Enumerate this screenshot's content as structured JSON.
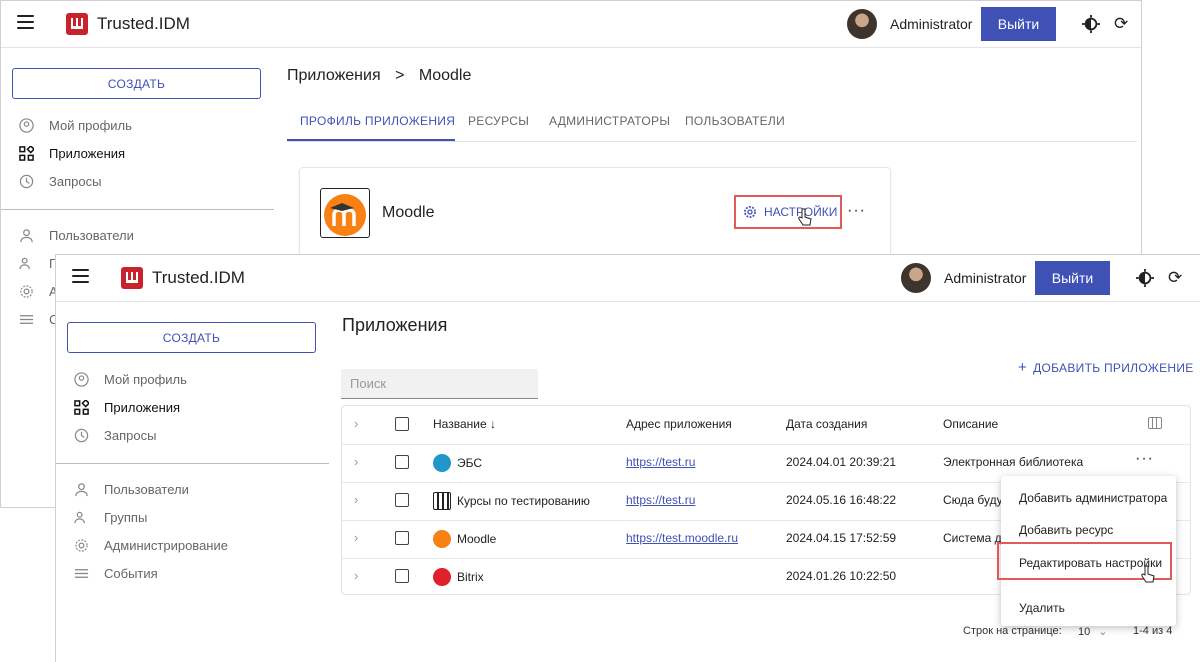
{
  "app": {
    "brand": "Trusted.IDM",
    "user": "Administrator",
    "logout": "Выйти"
  },
  "sidebar": {
    "create": "СОЗДАТЬ",
    "items": [
      "Мой профиль",
      "Приложения",
      "Запросы",
      "Пользователи",
      "Группы",
      "Администрирование",
      "События"
    ]
  },
  "back_window": {
    "breadcrumb_root": "Приложения",
    "breadcrumb_sep": ">",
    "breadcrumb_current": "Moodle",
    "tabs": [
      "ПРОФИЛЬ ПРИЛОЖЕНИЯ",
      "РЕСУРСЫ",
      "АДМИНИСТРАТОРЫ",
      "ПОЛЬЗОВАТЕЛИ"
    ],
    "card_title": "Moodle",
    "settings_button": "НАСТРОЙКИ",
    "more": "···"
  },
  "front_window": {
    "title": "Приложения",
    "add_app": "ДОБАВИТЬ ПРИЛОЖЕНИЕ",
    "search_placeholder": "Поиск",
    "columns": [
      "Название ↓",
      "Адрес приложения",
      "Дата создания",
      "Описание"
    ],
    "rows": [
      {
        "name": "ЭБС",
        "url": "https://test.ru",
        "date": "2024.04.01 20:39:21",
        "desc": "Электронная библиотека"
      },
      {
        "name": "Курсы по тестированию",
        "url": "https://test.ru",
        "date": "2024.05.16 16:48:22",
        "desc": "Сюда будут"
      },
      {
        "name": "Moodle",
        "url": "https://test.moodle.ru",
        "date": "2024.04.15 17:52:59",
        "desc": "Система ди"
      },
      {
        "name": "Bitrix",
        "url": "",
        "date": "2024.01.26 10:22:50",
        "desc": ""
      }
    ],
    "row_more": "···",
    "pager": {
      "label": "Строк на странице:",
      "value": "10",
      "range": "1-4 из 4"
    }
  },
  "context_menu": [
    "Добавить администратора",
    "Добавить ресурс",
    "Редактировать настройки",
    "Удалить"
  ]
}
